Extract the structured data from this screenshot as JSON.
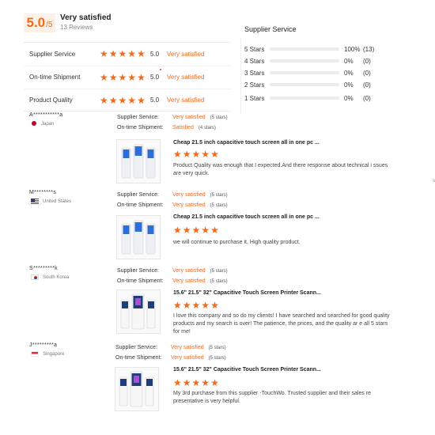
{
  "summary": {
    "score": "5.0",
    "score_of": "/5",
    "title": "Very satisfied",
    "reviews": "13 Reviews"
  },
  "ratings": [
    {
      "label": "Supplier Service",
      "score": "5.0",
      "text": "Very satisfied",
      "stars": 5
    },
    {
      "label": "On-time Shipment",
      "score": "5.0",
      "text": "Very satisfied",
      "stars": 5
    },
    {
      "label": "Product Quality",
      "score": "5.0",
      "text": "Very satisfied",
      "stars": 5
    }
  ],
  "distribution": {
    "title": "Supplier Service",
    "rows": [
      {
        "label": "5 Stars",
        "pct": "100%",
        "count": "(13)",
        "fill": 1.0
      },
      {
        "label": "4 Stars",
        "pct": "0%",
        "count": "(0)",
        "fill": 0
      },
      {
        "label": "3 Stars",
        "pct": "0%",
        "count": "(0)",
        "fill": 0
      },
      {
        "label": "2 Stars",
        "pct": "0%",
        "count": "(0)",
        "fill": 0
      },
      {
        "label": "1 Stars",
        "pct": "0%",
        "count": "(0)",
        "fill": 0
      }
    ]
  },
  "meta_labels": {
    "supplier": "Supplier Service:",
    "shipment": "On-time Shipment:"
  },
  "reviews": [
    {
      "buyer": "A***********a",
      "country": "Japan",
      "flag": "jp",
      "supplier_val": "Very satisfied",
      "supplier_count": "(5 stars)",
      "shipment_val": "Satisfied",
      "shipment_count": "(4 stars)",
      "product_title": "Cheap 21.5 inch capacitive touch screen all in one pc ...",
      "stars": 5,
      "text": "Product Quality was enough that I expected.And there response about technical i ssues are very quick."
    },
    {
      "buyer": "M********s",
      "country": "United States",
      "flag": "us",
      "supplier_val": "Very satisfied",
      "supplier_count": "(5 stars)",
      "shipment_val": "Very satisfied",
      "shipment_count": "(5 stars)",
      "product_title": "Cheap 21.5 inch capacitive touch screen all in one pc ...",
      "stars": 5,
      "text": "we will continue to purchase it, High quality product."
    },
    {
      "buyer": "S*********k",
      "country": "South Korea",
      "flag": "kr",
      "supplier_val": "Very satisfied",
      "supplier_count": "(5 stars)",
      "shipment_val": "Very satisfied",
      "shipment_count": "(5 stars)",
      "product_title": "15.6\" 21.5\" 32\" Capacitive Touch Screen Printer Scann...",
      "stars": 5,
      "text": "I love this company and so do my clients! I have searched and searched for good quality products and my search is over! The patience, the prices, and the quality ar e all 5 stars for me!"
    },
    {
      "buyer": "J*********a",
      "country": "Singapore",
      "flag": "sg",
      "supplier_val": "Very satisfied",
      "supplier_count": "(5 stars)",
      "shipment_val": "Very satisfied",
      "shipment_count": "(5 stars)",
      "product_title": "15.6\" 21.5\" 32\" Capacitive Touch Screen Printer Scann...",
      "stars": 5,
      "text": "My 3rd purchase from this supplier -TouchWo. Trusted supplier and their sales re presentative is very helpful."
    }
  ],
  "edge_mark": "s",
  "colors": {
    "accent": "#f26b1d",
    "accent_bg": "#fdf0e6",
    "kiosk_dark": "#1f3d7a",
    "kiosk_white": "#f4f4f4"
  },
  "icons": {
    "star": "★"
  }
}
